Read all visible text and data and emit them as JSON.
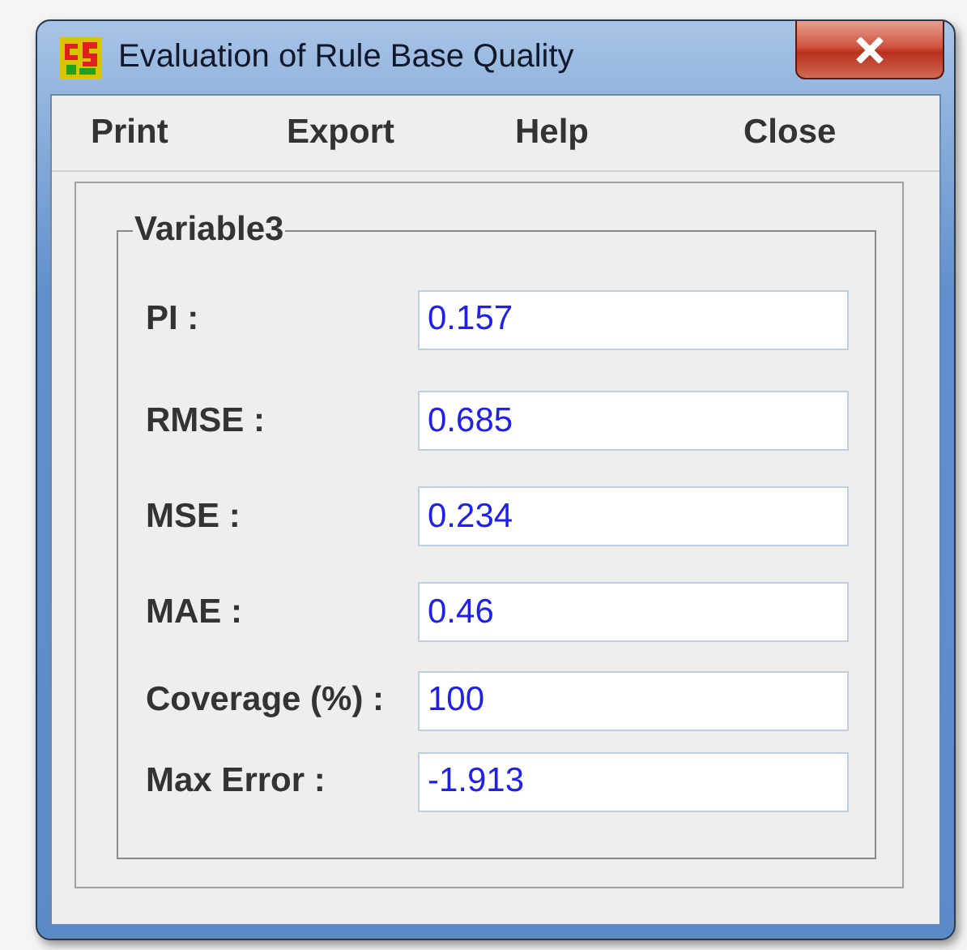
{
  "window": {
    "title": "Evaluation of Rule Base Quality"
  },
  "menu": [
    "Print",
    "Export",
    "Help",
    "Close"
  ],
  "group": {
    "title": "Variable3"
  },
  "fields": [
    {
      "label": "PI :",
      "value": "0.157"
    },
    {
      "label": "RMSE :",
      "value": "0.685"
    },
    {
      "label": "MSE :",
      "value": "0.234"
    },
    {
      "label": "MAE :",
      "value": "0.46"
    },
    {
      "label": "Coverage (%) :",
      "value": "100"
    },
    {
      "label": "Max Error :",
      "value": "-1.913"
    }
  ]
}
